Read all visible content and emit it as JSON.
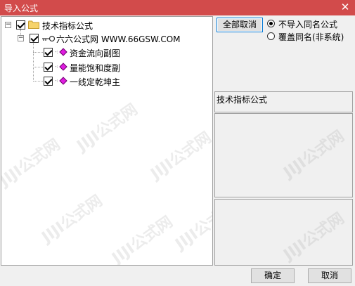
{
  "window": {
    "title": "导入公式",
    "close_glyph": "✕"
  },
  "tree": {
    "root": {
      "label": "技术指标公式",
      "expanded": true,
      "checked": true
    },
    "group": {
      "label": "六六公式网 WWW.66GSW.COM",
      "expanded": true,
      "checked": true
    },
    "items": [
      {
        "label": "资金流向副图",
        "checked": true
      },
      {
        "label": "量能饱和度副",
        "checked": true
      },
      {
        "label": "一线定乾坤主",
        "checked": true
      }
    ]
  },
  "options": {
    "deselect_all_label": "全部取消",
    "radios": [
      {
        "label": "不导入同名公式",
        "selected": true
      },
      {
        "label": "覆盖同名(非系统)",
        "selected": false
      }
    ]
  },
  "info": {
    "category_label": "技术指标公式"
  },
  "footer": {
    "ok_label": "确定",
    "cancel_label": "取消"
  },
  "watermark": {
    "text": "JIJI公式网"
  },
  "colors": {
    "titlebar": "#d24b4b",
    "item_icon": "#e01de0"
  }
}
